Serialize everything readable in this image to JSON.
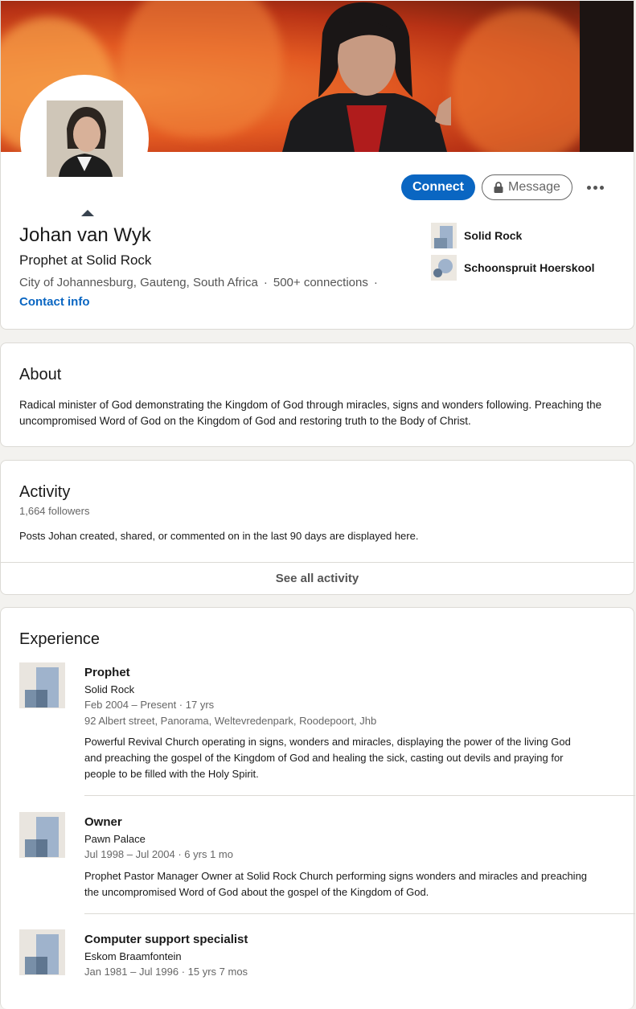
{
  "profile": {
    "name": "Johan van Wyk",
    "headline": "Prophet at Solid Rock",
    "location": "City of Johannesburg, Gauteng, South Africa",
    "connections": "500+ connections",
    "separator": "·",
    "contact_info": "Contact info"
  },
  "actions": {
    "connect": "Connect",
    "message": "Message"
  },
  "orgs": [
    {
      "label": "Solid Rock"
    },
    {
      "label": "Schoonspruit Hoerskool"
    }
  ],
  "about": {
    "title": "About",
    "text": "Radical minister of God demonstrating the Kingdom of God through miracles, signs and wonders following. Preaching the uncompromised Word of God on the Kingdom of God and restoring truth to the Body of Christ."
  },
  "activity": {
    "title": "Activity",
    "followers": "1,664 followers",
    "description": "Posts Johan created, shared, or commented on in the last 90 days are displayed here.",
    "see_all": "See all activity"
  },
  "experience": {
    "title": "Experience",
    "items": [
      {
        "title": "Prophet",
        "company": "Solid Rock",
        "dates": "Feb 2004 – Present · 17 yrs",
        "location": "92 Albert street, Panorama, Weltevredenpark, Roodepoort, Jhb",
        "description": "Powerful Revival Church operating in signs, wonders and miracles, displaying the power of the living God and preaching the gospel of the Kingdom of God and healing the sick, casting out devils and praying for people to be filled with the Holy Spirit."
      },
      {
        "title": "Owner",
        "company": "Pawn Palace",
        "dates": "Jul 1998 – Jul 2004 · 6 yrs 1 mo",
        "description": "Prophet Pastor Manager Owner at Solid Rock Church performing signs wonders and miracles and preaching the uncompromised Word of God about the gospel of the Kingdom of God."
      },
      {
        "title": "Computer support specialist",
        "company": "Eskom Braamfontein",
        "dates": "Jan 1981 – Jul 1996 · 15 yrs 7 mos"
      }
    ]
  },
  "colors": {
    "primary": "#0a66c2",
    "background": "#f3f2ef"
  },
  "icons": [
    "lock-icon",
    "more-dots-icon",
    "caret-up-icon",
    "company-logo-icon"
  ]
}
